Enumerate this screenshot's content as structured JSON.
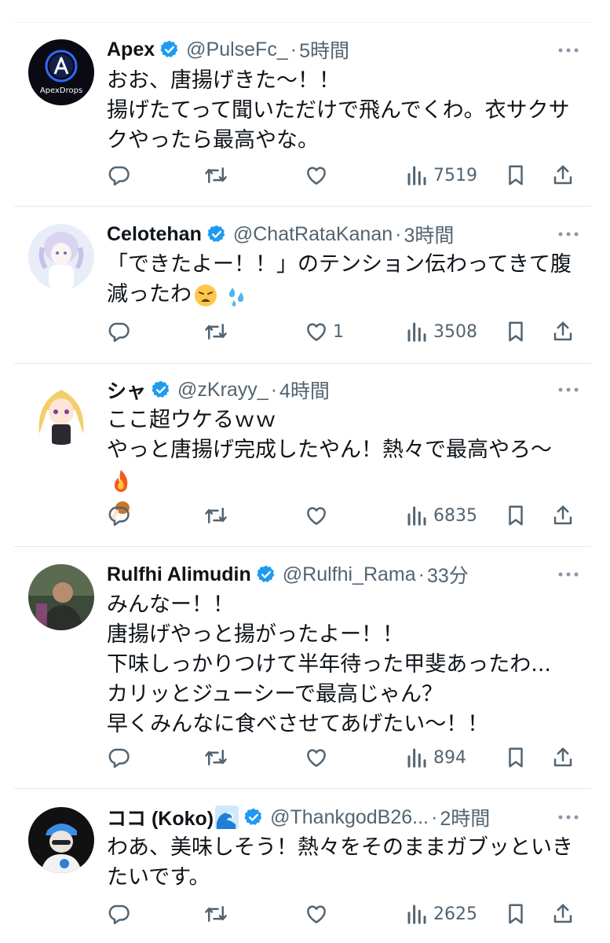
{
  "tweets": [
    {
      "name": "Apex",
      "handle": "@PulseFc_",
      "separator": "·",
      "time": "5時間",
      "avatar_text": "ApexDrops",
      "text_lines": [
        "おお、唐揚げきた〜！！",
        "揚げたてって聞いただけで飛んでくわ。衣サクサ",
        "クやったら最高やな。"
      ],
      "likes": "",
      "views": "7519"
    },
    {
      "name": "Celotehan",
      "handle": "@ChatRataKanan",
      "separator": "·",
      "time": "3時間",
      "text_lines": [
        "「できたよー！！」のテンション伝わってきて腹",
        "減ったわ"
      ],
      "likes": "1",
      "views": "3508"
    },
    {
      "name": "シャ",
      "handle": "@zKrayy_",
      "separator": "·",
      "time": "4時間",
      "text_lines": [
        "ここ超ウケるｗｗ",
        "やっと唐揚げ完成したやん！熱々で最高やろ〜"
      ],
      "likes": "",
      "views": "6835"
    },
    {
      "name": "Rulfhi Alimudin",
      "handle": "@Rulfhi_Rama",
      "separator": "·",
      "time": "33分",
      "text_lines": [
        "みんなー！！",
        "唐揚げやっと揚がったよー！！",
        "下味しっかりつけて半年待った甲斐あったわ...",
        "カリッとジューシーで最高じゃん？",
        "早くみんなに食べさせてあげたい〜！！"
      ],
      "likes": "",
      "views": "894"
    },
    {
      "name": "ココ (Koko)",
      "handle": "@ThankgodB26...",
      "separator": "·",
      "time": "2時間",
      "text_lines": [
        "わあ、美味しそう！熱々をそのままガブッといき",
        "たいです。"
      ],
      "likes": "",
      "views": "2625"
    }
  ],
  "icons": {
    "reply": "reply-icon",
    "retweet": "retweet-icon",
    "like": "heart-icon",
    "views": "views-icon",
    "bookmark": "bookmark-icon",
    "share": "share-icon",
    "more": "more-icon",
    "verified": "verified-badge-icon"
  },
  "colors": {
    "verified": "#1d9bf0",
    "secondary": "#536471",
    "text": "#0f1419"
  }
}
